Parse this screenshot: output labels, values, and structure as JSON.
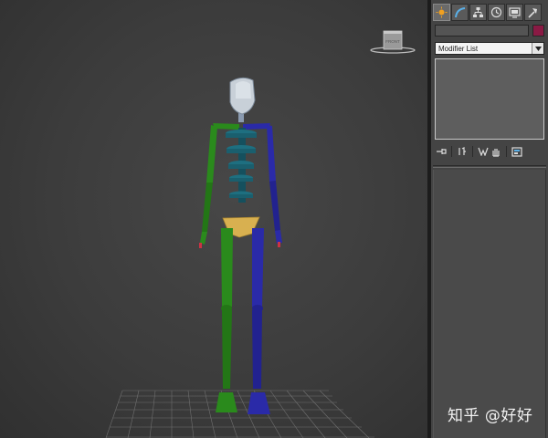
{
  "viewport": {
    "viewcube_label": "FRONT",
    "colors": {
      "head": "#c8d0d8",
      "spine": "#1e6f80",
      "left_limbs": "#2a8a1c",
      "right_limbs": "#2a2aa8",
      "pelvis": "#d8b050",
      "grid": "#6f6f6f"
    }
  },
  "command_panel": {
    "tabs": [
      {
        "icon": "sun-icon",
        "active": true
      },
      {
        "icon": "modify-icon",
        "active": false
      },
      {
        "icon": "hierarchy-icon",
        "active": false
      },
      {
        "icon": "motion-icon",
        "active": false
      },
      {
        "icon": "display-icon",
        "active": false
      },
      {
        "icon": "utilities-icon",
        "active": false
      }
    ],
    "object_name": "",
    "object_color": "#8a1a44",
    "modifier_list_label": "Modifier List",
    "stack_tools": [
      "pin-stack-icon",
      "show-end-result-icon",
      "make-unique-icon",
      "remove-modifier-icon",
      "configure-modifier-sets-icon"
    ]
  },
  "watermark": "知乎 @好好"
}
